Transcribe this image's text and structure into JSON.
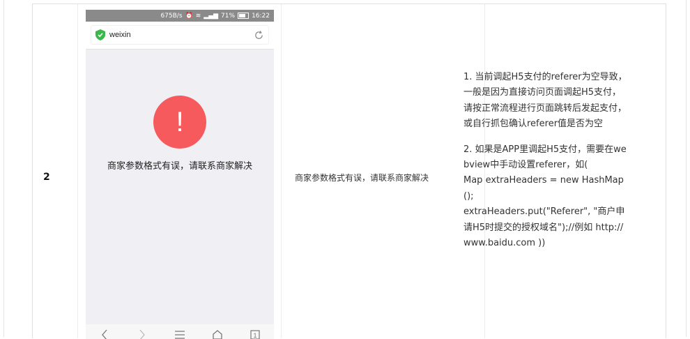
{
  "row": {
    "number": "2"
  },
  "phone": {
    "status": {
      "speed": "675B/s",
      "battery_pct": "71%",
      "time": "16:22"
    },
    "address": {
      "site": "weixin"
    },
    "alert": {
      "icon": "!",
      "message": "商家参数格式有误，请联系商家解决"
    },
    "nav": [
      "back",
      "forward",
      "menu",
      "home",
      "tabs"
    ],
    "tab_count": "1"
  },
  "error_message": "商家参数格式有误，请联系商家解决",
  "solution": {
    "p1": "1. 当前调起H5支付的referer为空导致，一般是因为直接访问页面调起H5支付，请按正常流程进行页面跳转后发起支付，或自行抓包确认referer值是否为空",
    "p2_lines": [
      "2. 如果是APP里调起H5支付，需要在webview中手动设置referer，如(",
      "Map extraHeaders = new HashMap();",
      "extraHeaders.put(\"Referer\", \"商户申请H5时提交的授权域名\");//例如 http://www.baidu.com ))"
    ]
  },
  "colors": {
    "alert_red": "#f65a5d",
    "status_bar": "#8a8a8a",
    "phone_bg": "#efeff4",
    "shield_green": "#3bb84b"
  }
}
